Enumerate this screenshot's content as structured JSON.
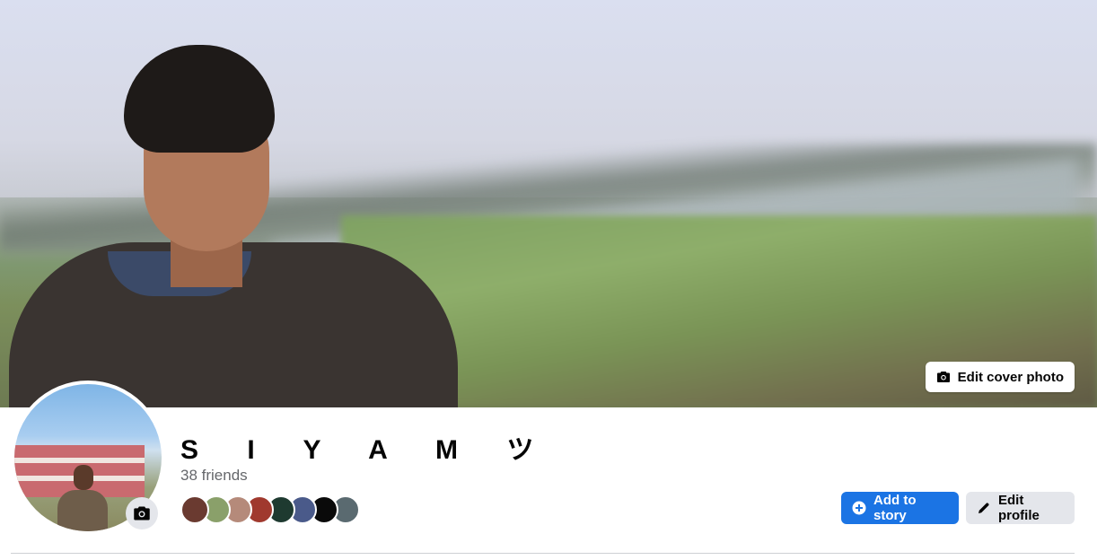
{
  "profile": {
    "name": "S I Y A M ツ",
    "friends_count_text": "38 friends"
  },
  "cover": {
    "edit_cover_label": "Edit cover photo"
  },
  "actions": {
    "add_to_story_label": "Add to story",
    "edit_profile_label": "Edit profile"
  },
  "friend_avatars": [
    {
      "color": "#6a3a30"
    },
    {
      "color": "#8aa06a"
    },
    {
      "color": "#b58a7a"
    },
    {
      "color": "#a0392e"
    },
    {
      "color": "#1e3a30"
    },
    {
      "color": "#4a5a8a"
    },
    {
      "color": "#0a0a0a"
    },
    {
      "color": "#5a6a70"
    }
  ],
  "colors": {
    "primary_button": "#1b74e4",
    "secondary_button": "#e4e6eb",
    "text_primary": "#050505",
    "text_secondary": "#65676b"
  },
  "icons": {
    "edit_cover": "camera-icon",
    "avatar_camera": "camera-icon",
    "add_story": "plus-circle-icon",
    "edit_profile": "pencil-icon"
  }
}
